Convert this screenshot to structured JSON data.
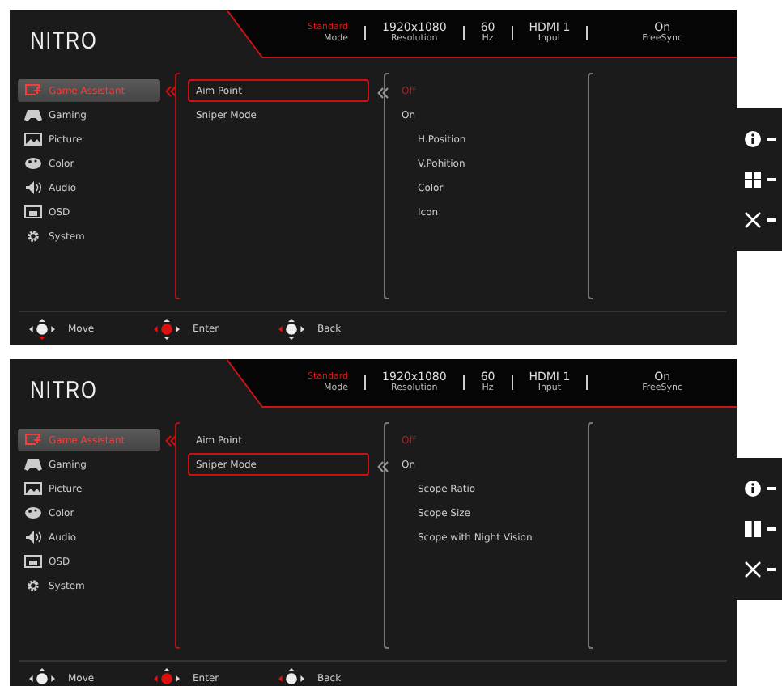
{
  "panels": [
    {
      "logo": "NITRO",
      "status": [
        {
          "value": "Standard",
          "label": "Mode",
          "highlighted": true
        },
        {
          "value": "1920x1080",
          "label": "Resolution",
          "highlighted": false
        },
        {
          "value": "60",
          "label": "Hz",
          "highlighted": false
        },
        {
          "value": "HDMI 1",
          "label": "Input",
          "highlighted": false
        },
        {
          "value": "On",
          "label": "FreeSync",
          "highlighted": false
        }
      ],
      "menu": [
        {
          "label": "Game Assistant",
          "kind": "assistant",
          "selected": true
        },
        {
          "label": "Gaming",
          "kind": "gaming",
          "selected": false
        },
        {
          "label": "Picture",
          "kind": "picture",
          "selected": false
        },
        {
          "label": "Color",
          "kind": "color",
          "selected": false
        },
        {
          "label": "Audio",
          "kind": "audio",
          "selected": false
        },
        {
          "label": "OSD",
          "kind": "osd",
          "selected": false
        },
        {
          "label": "System",
          "kind": "system",
          "selected": false
        }
      ],
      "submenu": [
        {
          "label": "Aim Point",
          "selected": true
        },
        {
          "label": "Sniper Mode",
          "selected": false
        }
      ],
      "options": [
        {
          "label": "Off",
          "selected": true
        },
        {
          "label": "On",
          "selected": false,
          "children": [
            {
              "label": "H.Position"
            },
            {
              "label": "V.Pohition"
            },
            {
              "label": "Color"
            },
            {
              "label": "Icon"
            }
          ]
        }
      ],
      "hotkeys": [
        {
          "kind": "info"
        },
        {
          "kind": "grid"
        },
        {
          "kind": "close"
        }
      ],
      "footer": [
        {
          "label": "Move",
          "kind": "move"
        },
        {
          "label": "Enter",
          "kind": "enter"
        },
        {
          "label": "Back",
          "kind": "back"
        }
      ]
    },
    {
      "logo": "NITRO",
      "status": [
        {
          "value": "Standard",
          "label": "Mode",
          "highlighted": true
        },
        {
          "value": "1920x1080",
          "label": "Resolution",
          "highlighted": false
        },
        {
          "value": "60",
          "label": "Hz",
          "highlighted": false
        },
        {
          "value": "HDMI 1",
          "label": "Input",
          "highlighted": false
        },
        {
          "value": "On",
          "label": "FreeSync",
          "highlighted": false
        }
      ],
      "menu": [
        {
          "label": "Game Assistant",
          "kind": "assistant",
          "selected": true
        },
        {
          "label": "Gaming",
          "kind": "gaming",
          "selected": false
        },
        {
          "label": "Picture",
          "kind": "picture",
          "selected": false
        },
        {
          "label": "Color",
          "kind": "color",
          "selected": false
        },
        {
          "label": "Audio",
          "kind": "audio",
          "selected": false
        },
        {
          "label": "OSD",
          "kind": "osd",
          "selected": false
        },
        {
          "label": "System",
          "kind": "system",
          "selected": false
        }
      ],
      "submenu": [
        {
          "label": "Aim Point",
          "selected": false
        },
        {
          "label": "Sniper Mode",
          "selected": true
        }
      ],
      "options": [
        {
          "label": "Off",
          "selected": true
        },
        {
          "label": "On",
          "selected": false,
          "children": [
            {
              "label": "Scope Ratio"
            },
            {
              "label": "Scope Size"
            },
            {
              "label": "Scope with Night Vision"
            }
          ]
        }
      ],
      "hotkeys": [
        {
          "kind": "info"
        },
        {
          "kind": "pause"
        },
        {
          "kind": "close"
        }
      ],
      "footer": [
        {
          "label": "Move",
          "kind": "move"
        },
        {
          "label": "Enter",
          "kind": "enter"
        },
        {
          "label": "Back",
          "kind": "back"
        }
      ]
    }
  ]
}
